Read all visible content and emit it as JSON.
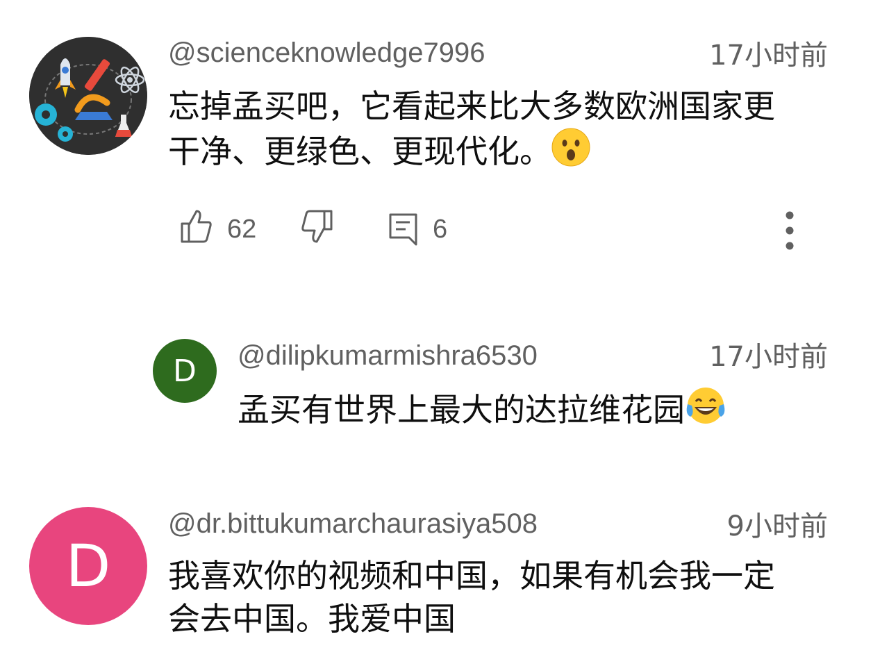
{
  "comments": [
    {
      "username": "@scienceknowledge7996",
      "timestamp": "17小时前",
      "text_line1": "忘掉孟买吧，它看起来比大多数欧洲国家更",
      "text_line2": "干净、更绿色、更现代化。",
      "emoji": "astonished-face",
      "likes": "62",
      "replies": "6"
    },
    {
      "username": "@dilipkumarmishra6530",
      "timestamp": "17小时前",
      "text": "孟买有世界上最大的达拉维花园",
      "emoji": "tears-of-joy-face",
      "avatar_letter": "D",
      "avatar_color": "#2e6b1e"
    },
    {
      "username": "@dr.bittukumarchaurasiya508",
      "timestamp": "9小时前",
      "text_line1": "我喜欢你的视频和中国，如果有机会我一定",
      "text_line2": "会去中国。我爱中国",
      "avatar_letter": "D",
      "avatar_color": "#e8457e"
    }
  ]
}
